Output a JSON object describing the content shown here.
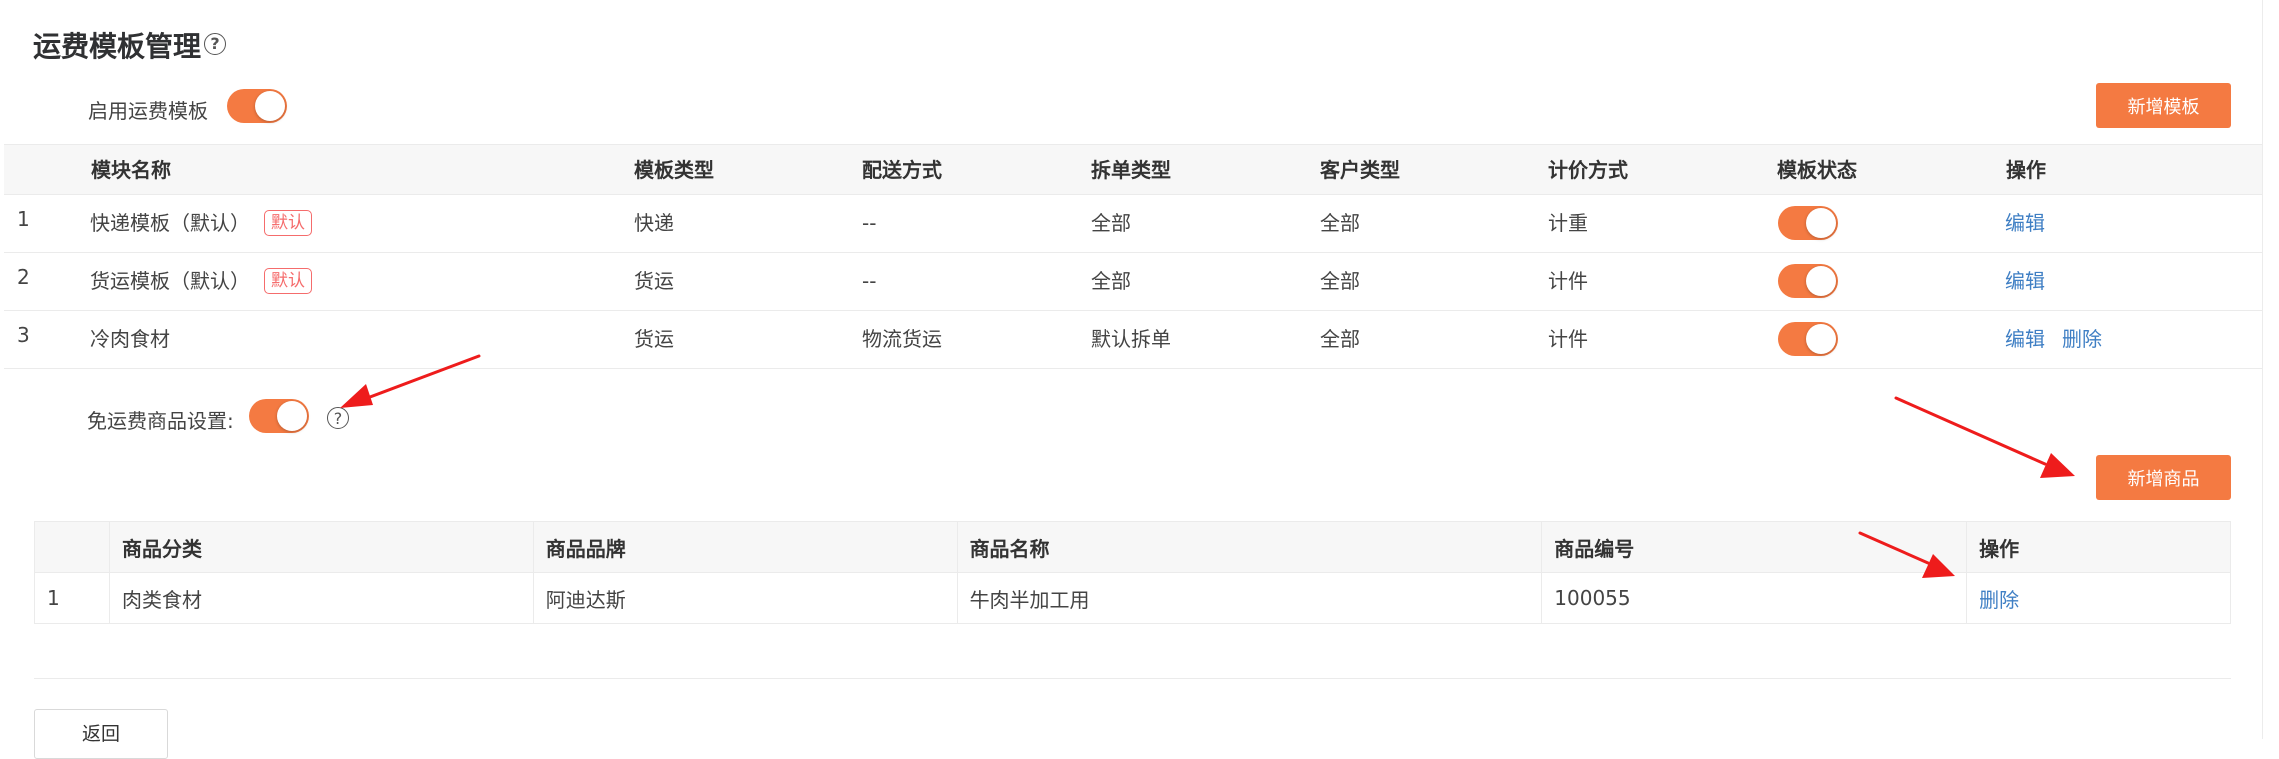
{
  "page": {
    "title": "运费模板管理",
    "help_glyph": "?",
    "enable_label": "启用运费模板",
    "enable_on": true,
    "add_template_label": "新增模板"
  },
  "template_table": {
    "headers": [
      "模块名称",
      "模板类型",
      "配送方式",
      "拆单类型",
      "客户类型",
      "计价方式",
      "模板状态",
      "操作"
    ],
    "rows": [
      {
        "index": "1",
        "name": "快递模板（默认）",
        "badge": "默认",
        "type": "快递",
        "delivery": "--",
        "split": "全部",
        "customer": "全部",
        "pricing": "计重",
        "status_on": true,
        "edit": "编辑",
        "delete": ""
      },
      {
        "index": "2",
        "name": "货运模板（默认）",
        "badge": "默认",
        "type": "货运",
        "delivery": "--",
        "split": "全部",
        "customer": "全部",
        "pricing": "计件",
        "status_on": true,
        "edit": "编辑",
        "delete": ""
      },
      {
        "index": "3",
        "name": "冷肉食材",
        "badge": "",
        "type": "货运",
        "delivery": "物流货运",
        "split": "默认拆单",
        "customer": "全部",
        "pricing": "计件",
        "status_on": true,
        "edit": "编辑",
        "delete": "删除"
      }
    ]
  },
  "free_shipping": {
    "label": "免运费商品设置:",
    "enabled": true,
    "help_glyph": "?",
    "add_goods_label": "新增商品",
    "headers": [
      "",
      "商品分类",
      "商品品牌",
      "商品名称",
      "商品编号",
      "操作"
    ],
    "rows": [
      {
        "index": "1",
        "category": "肉类食材",
        "brand": "阿迪达斯",
        "name": "牛肉半加工用",
        "code": "100055",
        "action": "删除"
      }
    ]
  },
  "footer": {
    "back_label": "返回"
  },
  "colors": {
    "accent": "#f47a42",
    "link": "#3f7fc4",
    "badge": "#f56c6c",
    "annotation_arrow": "#ee1c1c"
  }
}
